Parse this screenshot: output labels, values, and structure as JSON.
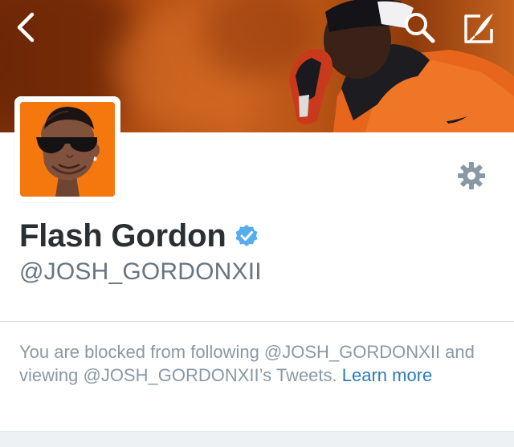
{
  "profile": {
    "display_name": "Flash Gordon",
    "handle": "@JOSH_GORDONXII",
    "verified": true
  },
  "blocked_notice": {
    "text": "You are blocked from following @JOSH_GORDONXII and viewing @JOSH_GORDONXII’s Tweets. ",
    "link_label": "Learn more"
  },
  "icons": {
    "back": "chevron-left-icon",
    "search": "search-icon",
    "compose": "compose-tweet-icon",
    "settings": "gear-icon",
    "verified": "verified-badge-icon"
  },
  "colors": {
    "name": "#292f33",
    "handle": "#66757f",
    "notice_text": "#8899a6",
    "link": "#2b7bb9",
    "verified": "#55acee",
    "avatar_bg": "#f5780e",
    "gear": "#8899a6"
  }
}
